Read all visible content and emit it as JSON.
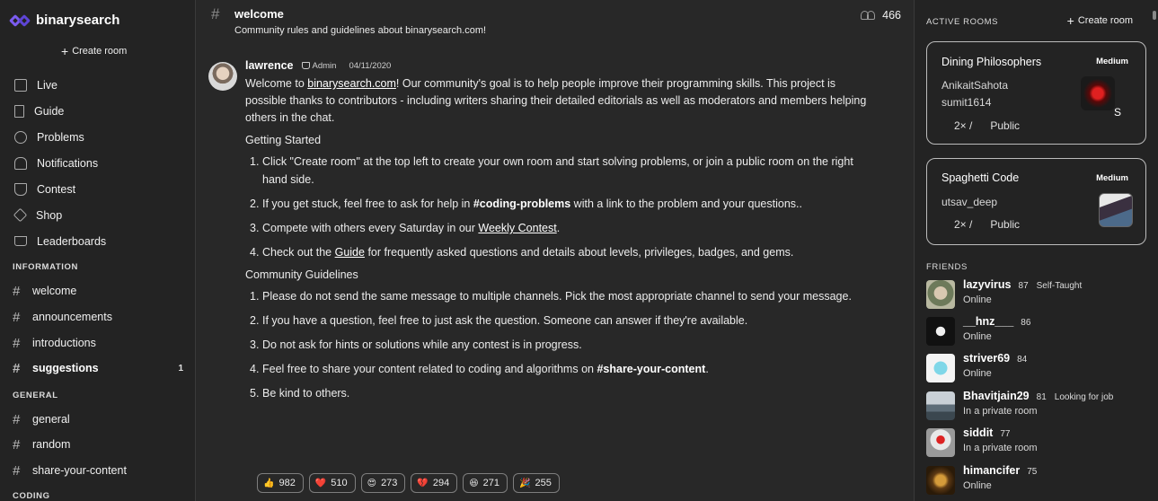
{
  "brand": {
    "name": "binarysearch"
  },
  "sidebar": {
    "create_room": "Create room",
    "nav": [
      {
        "label": "Live",
        "icon": "tv-icon"
      },
      {
        "label": "Guide",
        "icon": "book-icon"
      },
      {
        "label": "Problems",
        "icon": "globe-icon"
      },
      {
        "label": "Notifications",
        "icon": "bell-icon"
      },
      {
        "label": "Contest",
        "icon": "trophy-icon"
      },
      {
        "label": "Shop",
        "icon": "tag-icon"
      },
      {
        "label": "Leaderboards",
        "icon": "crown-icon"
      }
    ],
    "information_label": "INFORMATION",
    "information_channels": [
      {
        "name": "welcome"
      },
      {
        "name": "announcements"
      },
      {
        "name": "introductions"
      },
      {
        "name": "suggestions",
        "unread": "1"
      }
    ],
    "general_label": "GENERAL",
    "general_channels": [
      {
        "name": "general"
      },
      {
        "name": "random"
      },
      {
        "name": "share-your-content"
      }
    ],
    "coding_label": "CODING"
  },
  "channel": {
    "name": "welcome",
    "topic": "Community rules and guidelines about binarysearch.com!",
    "member_count": "466"
  },
  "message": {
    "author": "lawrence",
    "role": "Admin",
    "date": "04/11/2020",
    "intro_pre": "Welcome to ",
    "intro_link": "binarysearch.com",
    "intro_post": "! Our community's goal is to help people improve their programming skills. This project is possible thanks to contributors - including writers sharing their detailed editorials as well as moderators and members helping others in the chat.",
    "getting_started_heading": "Getting Started",
    "gs1": "Click \"Create room\" at the top left to create your own room and start solving problems, or join a public room on the right hand side.",
    "gs2_pre": "If you get stuck, feel free to ask for help in ",
    "gs2_bold": "#coding-problems",
    "gs2_post": " with a link to the problem and your questions..",
    "gs3_pre": "Compete with others every Saturday in our ",
    "gs3_link": "Weekly Contest",
    "gs3_post": ".",
    "gs4_pre": "Check out the ",
    "gs4_link": "Guide",
    "gs4_post": " for frequently asked questions and details about levels, privileges, badges, and gems.",
    "guidelines_heading": "Community Guidelines",
    "cg1": "Please do not send the same message to multiple channels. Pick the most appropriate channel to send your message.",
    "cg2": "If you have a question, feel free to just ask the question. Someone can answer if they're available.",
    "cg3": "Do not ask for hints or solutions while any contest is in progress.",
    "cg4_pre": "Feel free to share your content related to coding and algorithms on ",
    "cg4_bold": "#share-your-content",
    "cg4_post": ".",
    "cg5": "Be kind to others.",
    "reactions": [
      {
        "emoji": "👍",
        "count": "982"
      },
      {
        "emoji": "❤️",
        "count": "510"
      },
      {
        "emoji": "😍",
        "count": "273"
      },
      {
        "emoji": "💔",
        "count": "294"
      },
      {
        "emoji": "😆",
        "count": "271"
      },
      {
        "emoji": "🎉",
        "count": "255"
      }
    ]
  },
  "right_panel": {
    "active_rooms_label": "ACTIVE ROOMS",
    "create_room": "Create room",
    "rooms": [
      {
        "title": "Dining Philosophers",
        "level": "Medium",
        "users": [
          "AnikaitSahota",
          "sumit1614"
        ],
        "speed": "2×",
        "separator": "/",
        "visibility": "Public",
        "extra": "S"
      },
      {
        "title": "Spaghetti Code",
        "level": "Medium",
        "users": [
          "utsav_deep"
        ],
        "speed": "2×",
        "separator": "/",
        "visibility": "Public"
      }
    ],
    "friends_label": "FRIENDS",
    "friends": [
      {
        "name": "lazyvirus",
        "level": "87",
        "tag": "Self-Taught",
        "status": "Online"
      },
      {
        "name": "__hnz___",
        "level": "86",
        "tag": "",
        "status": "Online"
      },
      {
        "name": "striver69",
        "level": "84",
        "tag": "",
        "status": "Online"
      },
      {
        "name": "Bhavitjain29",
        "level": "81",
        "tag": "Looking for job",
        "status": "In a private room"
      },
      {
        "name": "siddit",
        "level": "77",
        "tag": "",
        "status": "In a private room"
      },
      {
        "name": "himancifer",
        "level": "75",
        "tag": "",
        "status": "Online"
      }
    ]
  },
  "colors": {
    "accent": "#7b5cf0",
    "background": "#282828",
    "sidebar": "#232323"
  }
}
